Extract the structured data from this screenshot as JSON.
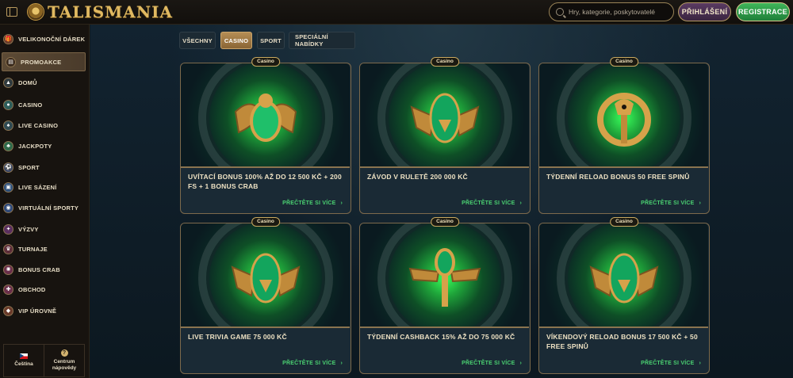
{
  "header": {
    "logo_text": "TALISMANIA",
    "search_placeholder": "Hry, kategorie, poskytovatelé",
    "login_label": "PŘIHLÁŠENÍ",
    "register_label": "REGISTRACE"
  },
  "sidebar": {
    "items": [
      {
        "label": "VELIKONOČNÍ DÁREK",
        "icon": "gift-icon"
      },
      {
        "label": "PROMOAKCE",
        "icon": "promo-icon"
      },
      {
        "label": "DOMŮ",
        "icon": "home-icon"
      },
      {
        "label": "CASINO",
        "icon": "casino-icon"
      },
      {
        "label": "LIVE CASINO",
        "icon": "spade-icon"
      },
      {
        "label": "JACKPOTY",
        "icon": "clover-icon"
      },
      {
        "label": "SPORT",
        "icon": "ball-icon"
      },
      {
        "label": "LIVE SÁZENÍ",
        "icon": "live-icon"
      },
      {
        "label": "VIRTUÁLNÍ SPORTY",
        "icon": "virtual-icon"
      },
      {
        "label": "VÝZVY",
        "icon": "challenge-icon"
      },
      {
        "label": "TURNAJE",
        "icon": "trophy-icon"
      },
      {
        "label": "BONUS CRAB",
        "icon": "crab-icon"
      },
      {
        "label": "OBCHOD",
        "icon": "shop-icon"
      },
      {
        "label": "VIP ÚROVNĚ",
        "icon": "diamond-icon"
      }
    ],
    "footer": {
      "language_label": "Čeština",
      "help_label_1": "Centrum",
      "help_label_2": "nápovědy"
    }
  },
  "tabs": [
    "VŠECHNY",
    "CASINO",
    "SPORT",
    "SPECIÁLNÍ NABÍDKY"
  ],
  "active_tab": "CASINO",
  "cards": [
    {
      "badge": "Casino",
      "title": "UVÍTACÍ BONUS 100% AŽ DO 12 500 KČ + 200 FS + 1 BONUS CRAB",
      "link": "PŘEČTĚTE SI VÍCE",
      "art": "scarab"
    },
    {
      "badge": "Casino",
      "title": "ZÁVOD V RULETĚ 200 000 KČ",
      "link": "PŘEČTĚTE SI VÍCE",
      "art": "wings"
    },
    {
      "badge": "Casino",
      "title": "TÝDENNÍ RELOAD BONUS 50 FREE SPINŮ",
      "link": "PŘEČTĚTE SI VÍCE",
      "art": "eye"
    },
    {
      "badge": "Casino",
      "title": "LIVE TRIVIA GAME 75 000 KČ",
      "link": "PŘEČTĚTE SI VÍCE",
      "art": "wings"
    },
    {
      "badge": "Casino",
      "title": "TÝDENNÍ CASHBACK 15% AŽ DO 75 000 KČ",
      "link": "PŘEČTĚTE SI VÍCE",
      "art": "ankh"
    },
    {
      "badge": "Casino",
      "title": "VÍKENDOVÝ RELOAD BONUS 17 500 KČ + 50 FREE SPINŮ",
      "link": "PŘEČTĚTE SI VÍCE",
      "art": "wings"
    }
  ],
  "colors": {
    "accent_green": "#4ad071",
    "gold": "#c9a960",
    "active_tab": "#b48d55"
  }
}
